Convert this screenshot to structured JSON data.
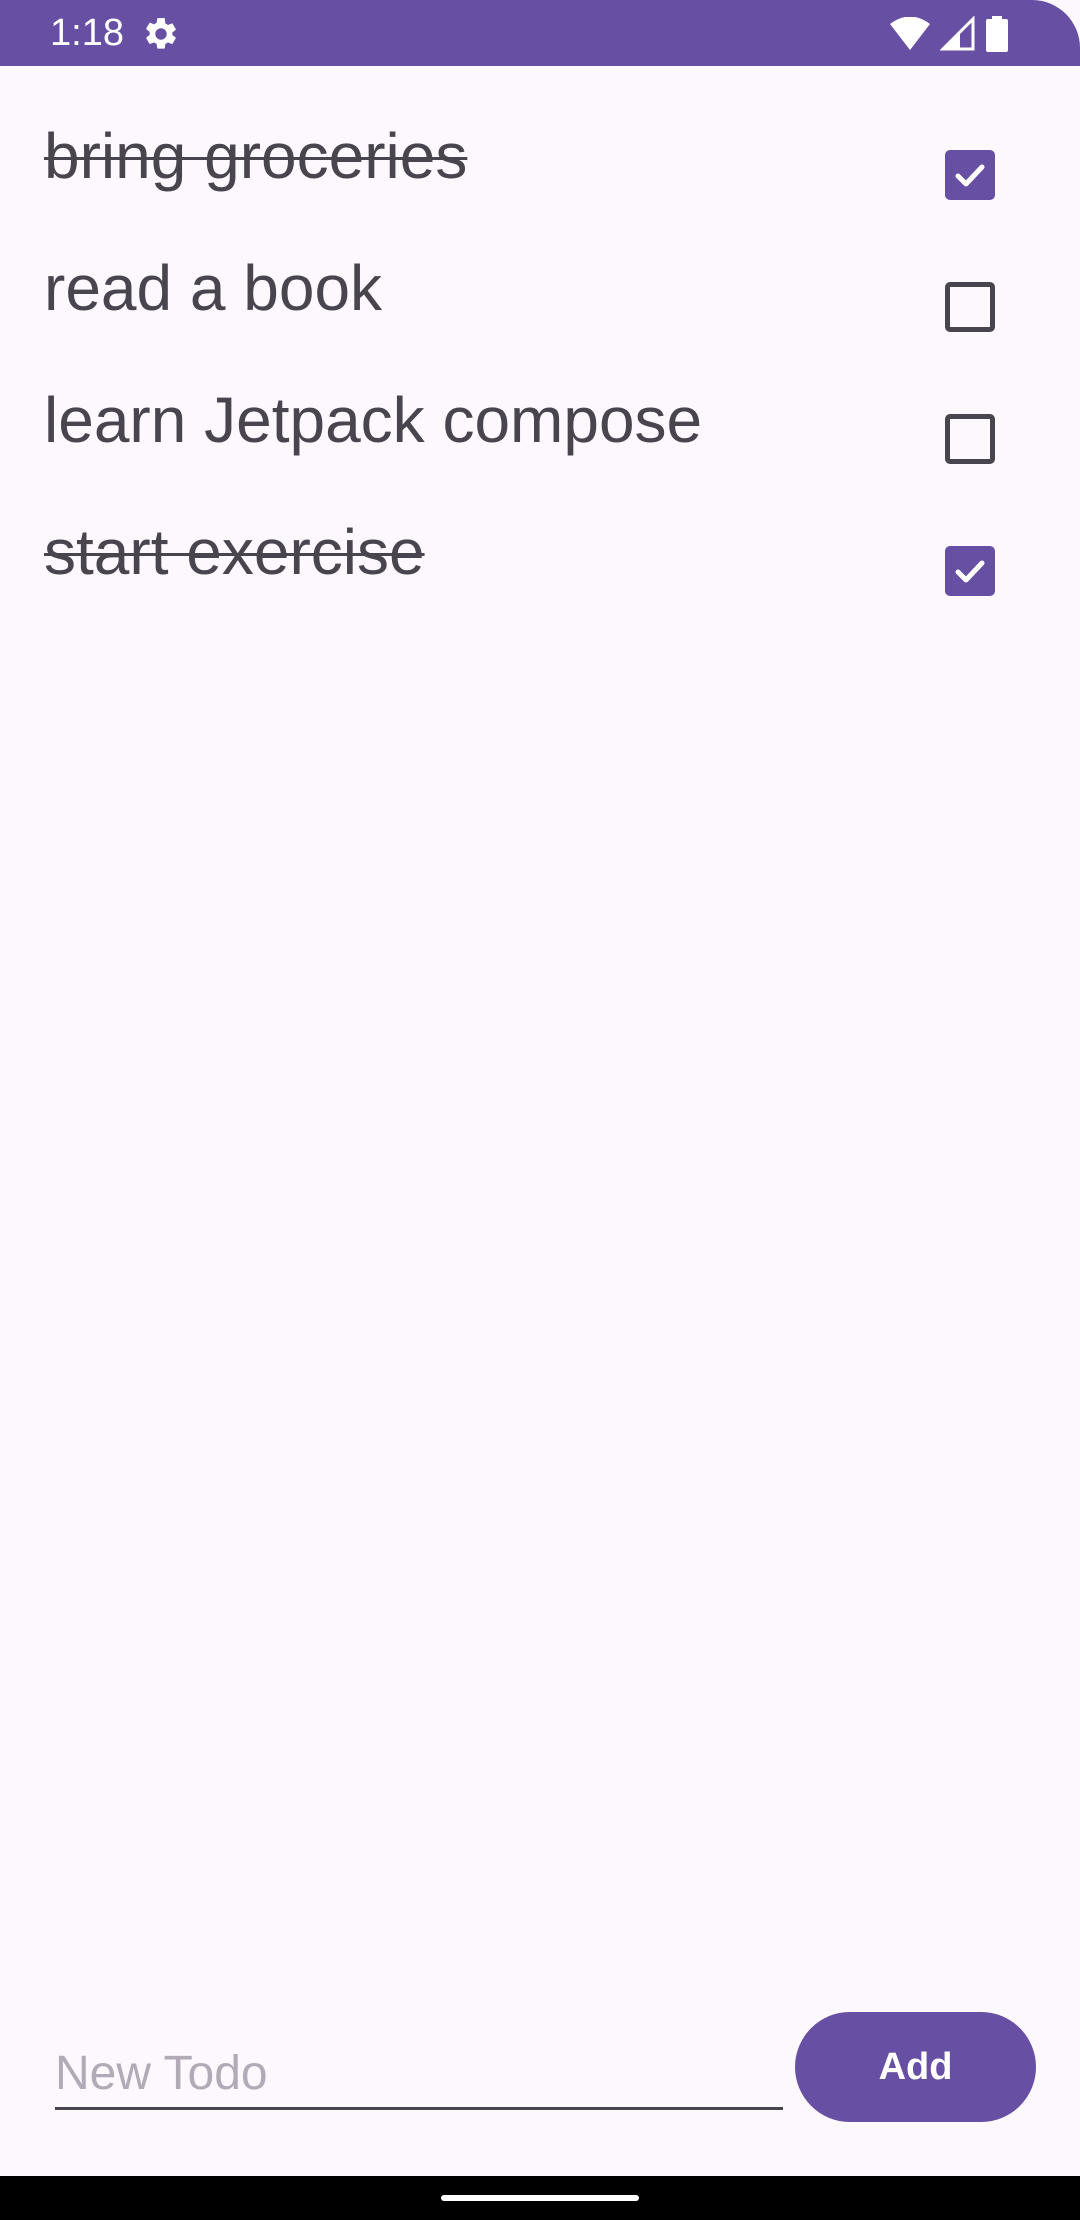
{
  "status_bar": {
    "time": "1:18",
    "icons": [
      "gear-icon",
      "wifi-icon",
      "signal-icon",
      "battery-icon"
    ],
    "color": "#6750a4"
  },
  "todos": [
    {
      "text": "bring groceries",
      "done": true
    },
    {
      "text": "read a book",
      "done": false
    },
    {
      "text": "learn Jetpack compose",
      "done": false
    },
    {
      "text": "start exercise",
      "done": true
    }
  ],
  "new_todo": {
    "placeholder": "New Todo",
    "value": ""
  },
  "add_button": {
    "label": "Add"
  },
  "colors": {
    "accent": "#6750a4",
    "background": "#fdf7fe",
    "text": "#49454f"
  }
}
